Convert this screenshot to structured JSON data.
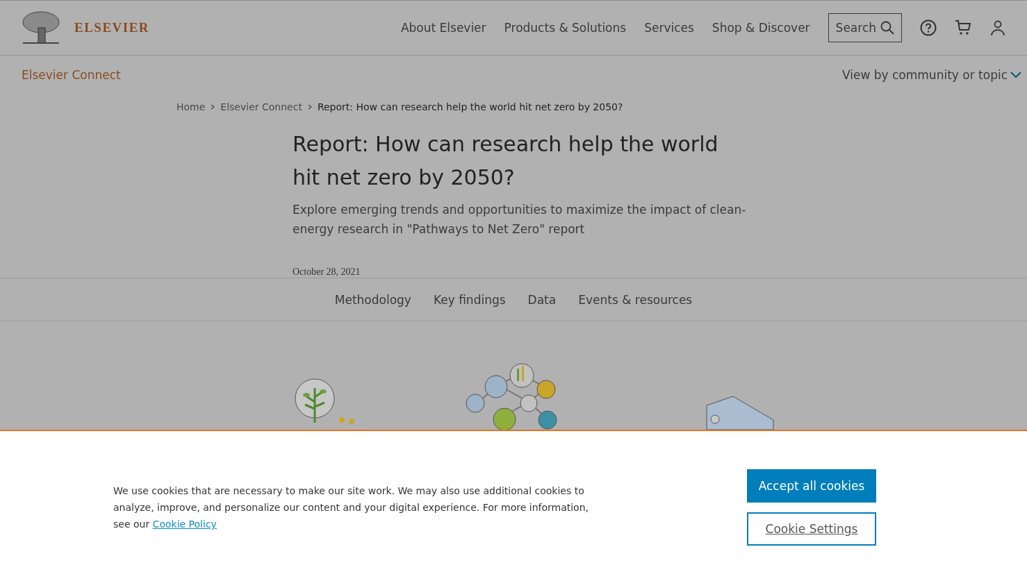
{
  "header": {
    "logo_text": "ELSEVIER",
    "nav": [
      "About Elsevier",
      "Products & Solutions",
      "Services",
      "Shop & Discover"
    ],
    "search_label": "Search"
  },
  "subnav": {
    "title": "Elsevier Connect",
    "community_menu": "View by community or topic"
  },
  "breadcrumb": [
    "Home",
    "Elsevier Connect",
    "Report: How can research help the world hit net zero by 2050?"
  ],
  "article": {
    "title": "Report: How can research help the world hit net zero by 2050?",
    "subtitle": "Explore emerging trends and opportunities to maximize the impact of clean-energy research in \"Pathways to Net Zero\" report",
    "date": "October 28, 2021"
  },
  "section_tabs": [
    "Methodology",
    "Key findings",
    "Data",
    "Events & resources"
  ],
  "cookie_banner": {
    "text": "We use cookies that are necessary to make our site work. We may also use additional cookies to analyze, improve, and personalize our content and your digital experience. For more information, see our",
    "link": "Cookie Policy",
    "buttons": [
      {
        "kind": "primary",
        "label": "Accept all cookies"
      },
      {
        "kind": "secondary",
        "label": "Cookie Settings"
      }
    ]
  }
}
